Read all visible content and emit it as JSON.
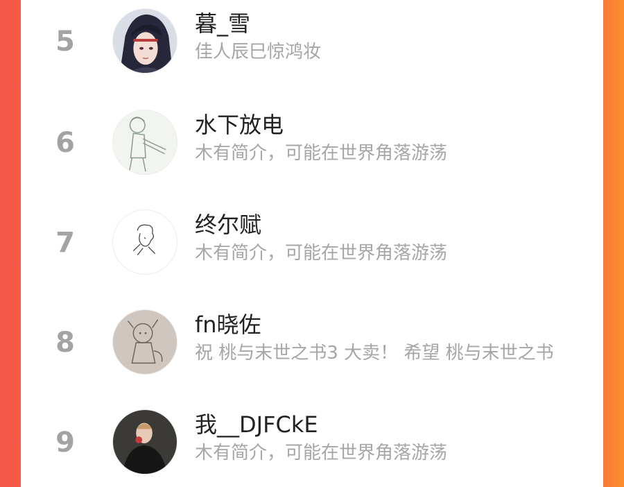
{
  "colors": {
    "left_edge": "#f4574a",
    "right_edge": "#fb7a36",
    "rank_color": "#a3a3a3",
    "name_color": "#222222",
    "bio_color": "#a6a6a6"
  },
  "ranking": [
    {
      "rank": "5",
      "name": "暮_雪",
      "bio": "佳人辰巳惊鸿妆",
      "avatar_icon": "anime-character-avatar-icon"
    },
    {
      "rank": "6",
      "name": "水下放电",
      "bio": "木有简介，可能在世界角落游荡",
      "avatar_icon": "sketch-figure-avatar-icon"
    },
    {
      "rank": "7",
      "name": "终尔赋",
      "bio": "木有简介，可能在世界角落游荡",
      "avatar_icon": "line-sketch-avatar-icon"
    },
    {
      "rank": "8",
      "name": "fn晓佐",
      "bio": "祝 桃与末世之书3 大卖！ 希望 桃与末世之书",
      "avatar_icon": "pencil-drawing-avatar-icon"
    },
    {
      "rank": "9",
      "name": "我__DJFCkE",
      "bio": "木有简介，可能在世界角落游荡",
      "avatar_icon": "photo-portrait-avatar-icon"
    }
  ]
}
